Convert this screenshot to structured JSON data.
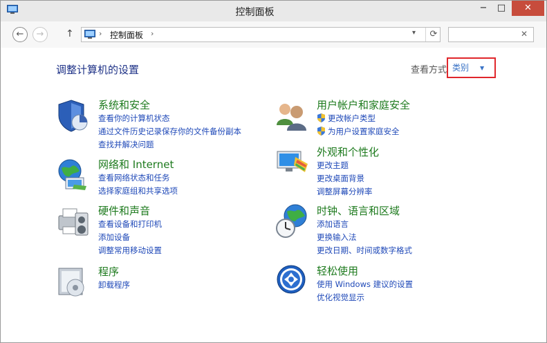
{
  "window": {
    "title": "控制面板"
  },
  "navbar": {
    "back_icon": "arrow-left-icon",
    "forward_icon": "arrow-right-icon",
    "up_icon": "arrow-up-icon",
    "address": "控制面板",
    "search_placeholder": ""
  },
  "main": {
    "page_title": "调整计算机的设置",
    "view_by_label": "查看方式",
    "view_by_value": "类别",
    "categories": [
      {
        "title": "系统和安全",
        "links": [
          "查看你的计算机状态",
          "通过文件历史记录保存你的文件备份副本",
          "查找并解决问题"
        ]
      },
      {
        "title": "网络和 Internet",
        "links": [
          "查看网络状态和任务",
          "选择家庭组和共享选项"
        ]
      },
      {
        "title": "硬件和声音",
        "links": [
          "查看设备和打印机",
          "添加设备",
          "调整常用移动设置"
        ]
      },
      {
        "title": "程序",
        "links": [
          "卸载程序"
        ]
      },
      {
        "title": "用户帐户和家庭安全",
        "links": [
          "更改帐户类型",
          "为用户设置家庭安全"
        ]
      },
      {
        "title": "外观和个性化",
        "links": [
          "更改主题",
          "更改桌面背景",
          "调整屏幕分辨率"
        ]
      },
      {
        "title": "时钟、语言和区域",
        "links": [
          "添加语言",
          "更换输入法",
          "更改日期、时间或数字格式"
        ]
      },
      {
        "title": "轻松使用",
        "links": [
          "使用 Windows 建议的设置",
          "优化视觉显示"
        ]
      }
    ]
  },
  "colors": {
    "link": "#1f49b8",
    "category_title": "#1d7a1d",
    "page_title": "#1e3287",
    "highlight_border": "#e0262b"
  }
}
